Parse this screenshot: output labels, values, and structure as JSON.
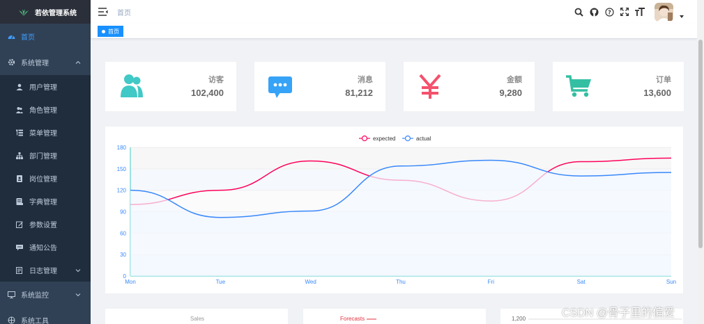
{
  "app": {
    "title": "若依管理系统"
  },
  "sidebar": {
    "items": [
      {
        "label": "首页",
        "icon": "dashboard-icon"
      },
      {
        "label": "系统管理",
        "icon": "gear-icon"
      },
      {
        "label": "系统监控",
        "icon": "monitor-icon"
      },
      {
        "label": "系统工具",
        "icon": "tool-icon"
      }
    ],
    "submenu": [
      {
        "label": "用户管理",
        "icon": "user-icon"
      },
      {
        "label": "角色管理",
        "icon": "peoples-icon"
      },
      {
        "label": "菜单管理",
        "icon": "tree-table-icon"
      },
      {
        "label": "部门管理",
        "icon": "tree-icon"
      },
      {
        "label": "岗位管理",
        "icon": "post-icon"
      },
      {
        "label": "字典管理",
        "icon": "dict-icon"
      },
      {
        "label": "参数设置",
        "icon": "edit-icon"
      },
      {
        "label": "通知公告",
        "icon": "message-icon"
      },
      {
        "label": "日志管理",
        "icon": "log-icon"
      }
    ]
  },
  "navbar": {
    "breadcrumb": "首页",
    "tools": [
      "search-icon",
      "github-icon",
      "question-icon",
      "fullscreen-icon",
      "font-size-icon"
    ]
  },
  "tags": {
    "home": "首页"
  },
  "panels": [
    {
      "label": "访客",
      "value": "102,400",
      "icon": "peoples-icon",
      "color": "#40c9c6"
    },
    {
      "label": "消息",
      "value": "81,212",
      "icon": "message-icon",
      "color": "#36a3f7"
    },
    {
      "label": "金额",
      "value": "9,280",
      "icon": "money-icon",
      "color": "#f4516c"
    },
    {
      "label": "订单",
      "value": "13,600",
      "icon": "shopping-icon",
      "color": "#34bfa3"
    }
  ],
  "chart_data": {
    "type": "line",
    "categories": [
      "Mon",
      "Tue",
      "Wed",
      "Thu",
      "Fri",
      "Sat",
      "Sun"
    ],
    "series": [
      {
        "name": "expected",
        "values": [
          100,
          120,
          161,
          134,
          105,
          160,
          165
        ],
        "color": "#ff005a"
      },
      {
        "name": "actual",
        "values": [
          120,
          82,
          91,
          154,
          162,
          140,
          145
        ],
        "color": "#3888fa"
      }
    ],
    "yticks": [
      "0",
      "30",
      "60",
      "90",
      "120",
      "150",
      "180"
    ],
    "ylim": [
      0,
      180
    ],
    "legend": "top-center",
    "grid": true
  },
  "bottom_cards": [
    {
      "title": "Sales"
    },
    {
      "title": "Forecasts"
    },
    {
      "title": "1,200"
    }
  ],
  "watermark": "CSDN @骨子里的偏爱"
}
